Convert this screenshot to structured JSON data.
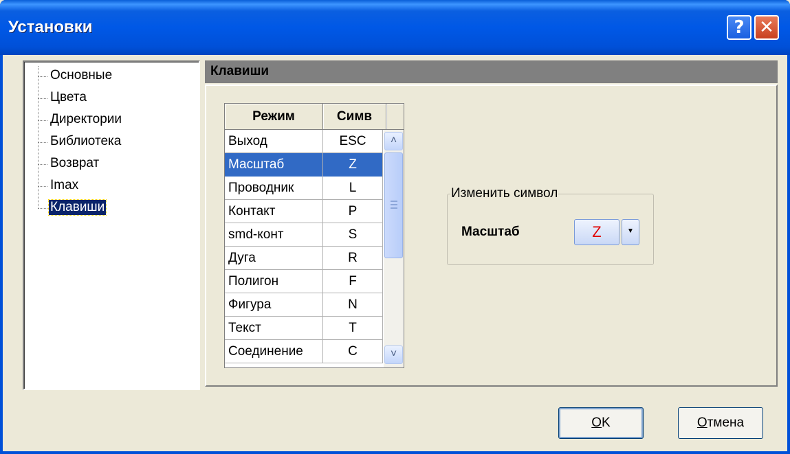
{
  "window": {
    "title": "Установки",
    "help_label": "?",
    "close_label": "✕"
  },
  "tree": {
    "items": [
      {
        "label": "Основные"
      },
      {
        "label": "Цвета"
      },
      {
        "label": "Директории"
      },
      {
        "label": "Библиотека"
      },
      {
        "label": "Возврат"
      },
      {
        "label": "Imax"
      },
      {
        "label": "Клавиши",
        "selected": true
      }
    ]
  },
  "panel": {
    "header": "Клавиши"
  },
  "table": {
    "columns": [
      "Режим",
      "Симв"
    ],
    "rows": [
      {
        "mode": "Выход",
        "symbol": "ESC"
      },
      {
        "mode": "Масштаб",
        "symbol": "Z",
        "selected": true
      },
      {
        "mode": "Проводник",
        "symbol": "L"
      },
      {
        "mode": "Контакт",
        "symbol": "P"
      },
      {
        "mode": "smd-конт",
        "symbol": "S"
      },
      {
        "mode": "Дуга",
        "symbol": "R"
      },
      {
        "mode": "Полигон",
        "symbol": "F"
      },
      {
        "mode": "Фигура",
        "symbol": "N"
      },
      {
        "mode": "Текст",
        "symbol": "T"
      },
      {
        "mode": "Соединение",
        "symbol": "C"
      }
    ],
    "scroll_up_icon": "chevron-up-icon",
    "scroll_down_icon": "chevron-down-icon"
  },
  "change_symbol": {
    "group_title": "Изменить символ",
    "mode_label": "Масштаб",
    "symbol_value": "Z",
    "symbol_color": "#E00000"
  },
  "buttons": {
    "ok_accel": "O",
    "ok_rest": "K",
    "cancel_accel": "О",
    "cancel_rest": "тмена"
  },
  "colors": {
    "title_bar": "#0058E6",
    "selection": "#316AC5",
    "dialog_bg": "#ECE9D8"
  }
}
